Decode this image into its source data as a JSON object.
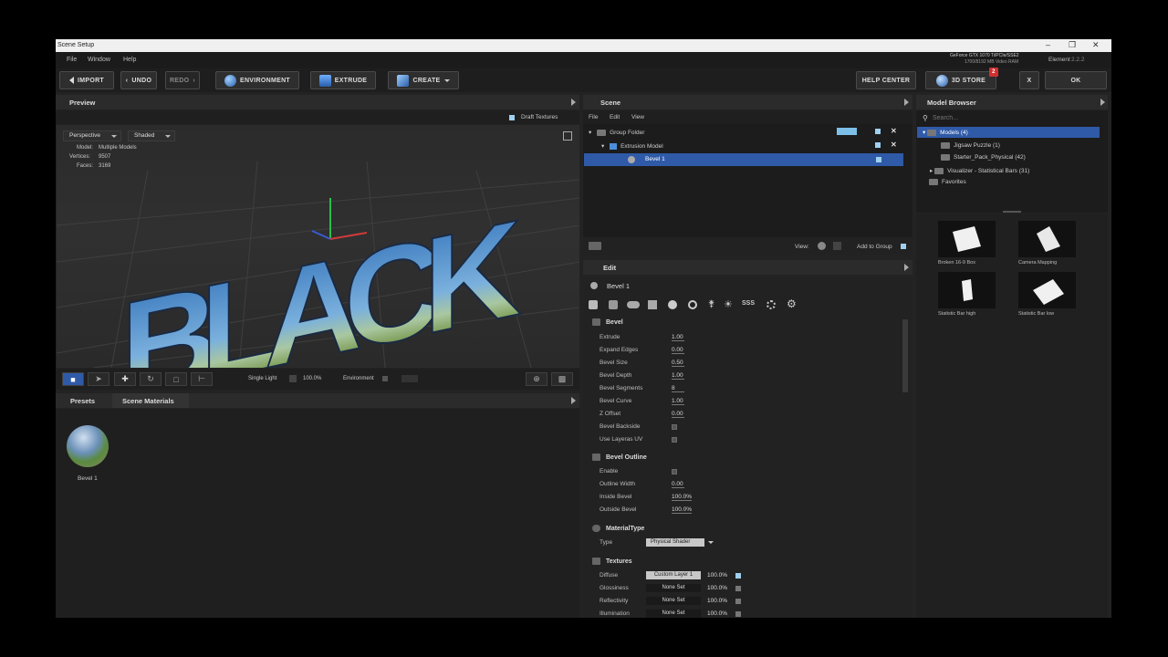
{
  "window": {
    "title": "Scene Setup"
  },
  "menu": [
    "File",
    "Window",
    "Help"
  ],
  "gpu": {
    "line1": "GeForce GTX 1070 Ti/PCIe/SSE2",
    "line2": "1700/8192 MB Video RAM",
    "version_label": "Element",
    "version": "2.2.2"
  },
  "toolbar": {
    "import": "IMPORT",
    "undo": "UNDO",
    "redo": "REDO",
    "environment": "ENVIRONMENT",
    "extrude": "EXTRUDE",
    "create": "CREATE",
    "help_center": "HELP CENTER",
    "store": "3D STORE",
    "store_badge": "2",
    "close": "X",
    "ok": "OK"
  },
  "preview": {
    "title": "Preview",
    "draft_textures": "Draft Textures",
    "camera_mode": "Perspective",
    "shading_mode": "Shaded",
    "model_label": "Model:",
    "model_value": "Multiple Models",
    "vertices_label": "Vertices:",
    "vertices_value": "9507",
    "faces_label": "Faces:",
    "faces_value": "3169",
    "viewport_text": "BLACK",
    "lighting": "Single Light",
    "zoom": "100.0%",
    "environment_label": "Environment"
  },
  "presets": {
    "tab_presets": "Presets",
    "tab_materials": "Scene Materials",
    "material_name": "Bevel 1"
  },
  "scene": {
    "title": "Scene",
    "menu": [
      "File",
      "Edit",
      "View"
    ],
    "items": [
      {
        "label": "Group Folder"
      },
      {
        "label": "Extrusion Model"
      },
      {
        "label": "Bevel 1"
      }
    ],
    "view_label": "View:",
    "add_to_group": "Add to Group"
  },
  "edit": {
    "title": "Edit",
    "object_name": "Bevel 1",
    "bevel_section": "Bevel",
    "bevel": [
      {
        "label": "Extrude",
        "value": "1.00"
      },
      {
        "label": "Expand Edges",
        "value": "0.00"
      },
      {
        "label": "Bevel Size",
        "value": "0.50"
      },
      {
        "label": "Bevel Depth",
        "value": "1.00"
      },
      {
        "label": "Bevel Segments",
        "value": "8"
      },
      {
        "label": "Bevel Curve",
        "value": "1.00"
      },
      {
        "label": "Z Offset",
        "value": "0.00"
      },
      {
        "label": "Bevel Backside",
        "value": ""
      },
      {
        "label": "Use Layeras UV",
        "value": ""
      }
    ],
    "outline_section": "Bevel Outline",
    "outline": [
      {
        "label": "Enable",
        "value": ""
      },
      {
        "label": "Outline Width",
        "value": "0.00"
      },
      {
        "label": "Inside Bevel",
        "value": "100.0%"
      },
      {
        "label": "Outside Bevel",
        "value": "100.0%"
      }
    ],
    "material_section": "MaterialType",
    "type_label": "Type",
    "type_value": "Physical Shader",
    "textures_section": "Textures",
    "textures": [
      {
        "label": "Diffuse",
        "layer": "Custom Layer 1",
        "value": "100.0%"
      },
      {
        "label": "Glossiness",
        "layer": "None Set",
        "value": "100.0%"
      },
      {
        "label": "Reflectivity",
        "layer": "None Set",
        "value": "100.0%"
      },
      {
        "label": "Illumination",
        "layer": "None Set",
        "value": "100.0%"
      }
    ]
  },
  "browser": {
    "title": "Model Browser",
    "search_placeholder": "Search...",
    "tree": [
      {
        "label": "Models (4)"
      },
      {
        "label": "Jigsaw Puzzle (1)"
      },
      {
        "label": "Starter_Pack_Physical (42)"
      },
      {
        "label": "Visualizer - Statistical Bars (31)"
      },
      {
        "label": "Favorites"
      }
    ],
    "thumbs": [
      {
        "label": "Broken 16-9 Box"
      },
      {
        "label": "Camera Mapping"
      },
      {
        "label": "Statistic Bar high"
      },
      {
        "label": "Statistic Bar low"
      }
    ]
  },
  "colors": {
    "accent": "#2f5aa8",
    "check": "#9fd0f0",
    "badge": "#d03030"
  }
}
